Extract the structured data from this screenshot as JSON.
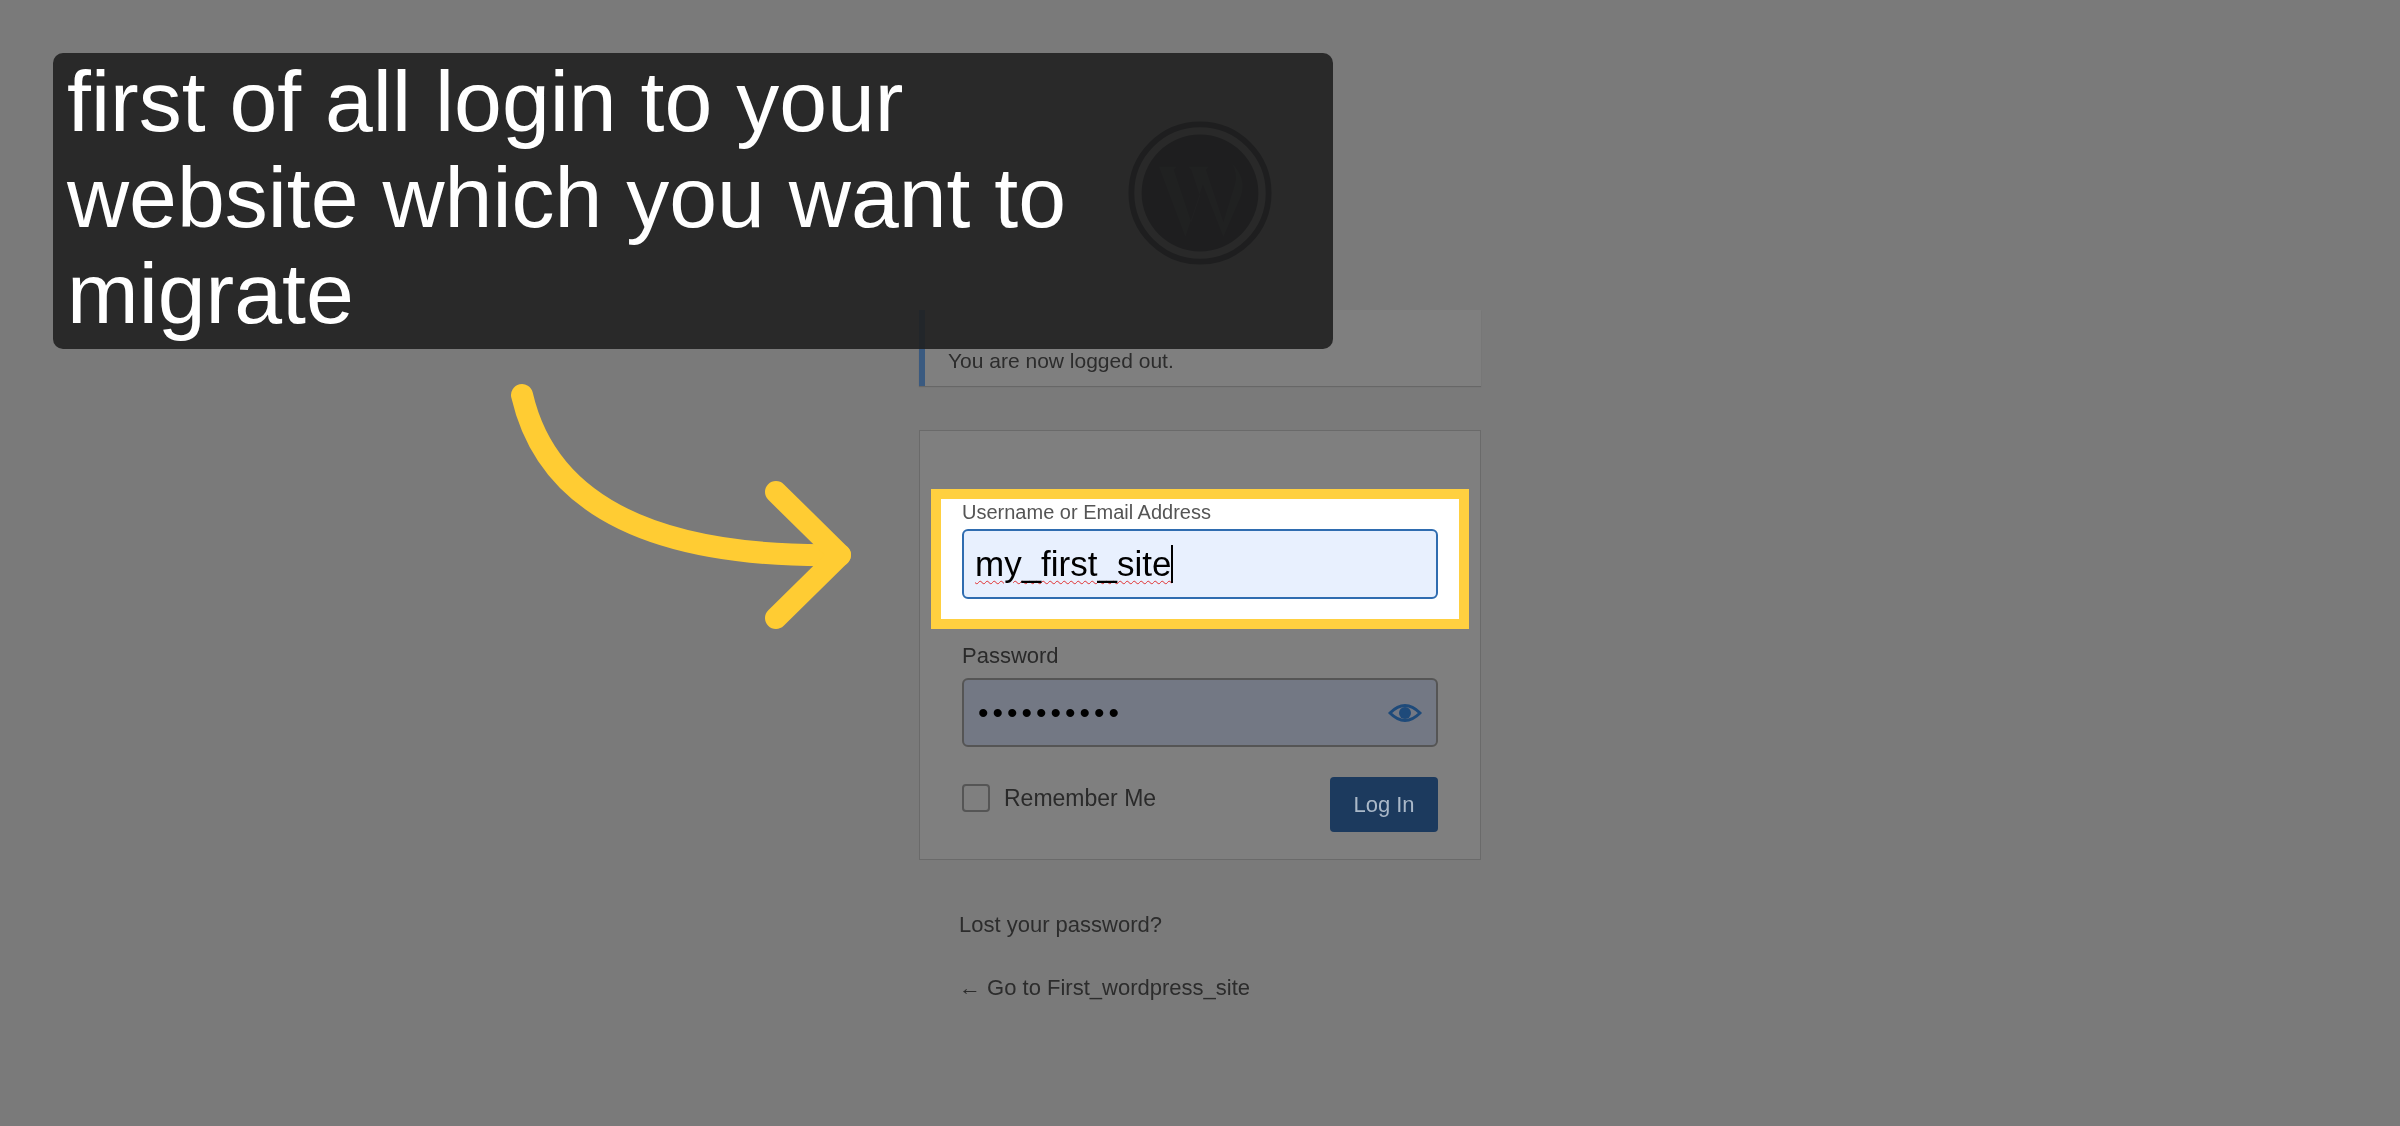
{
  "caption": {
    "text": "first of all login to your website which you want to migrate"
  },
  "notice": {
    "text": "You are now logged out."
  },
  "login_form": {
    "username": {
      "label": "Username or Email Address",
      "value": "my_first_site",
      "highlighted": true
    },
    "password": {
      "label": "Password",
      "value": "••••••••••"
    },
    "remember_me": {
      "label": "Remember Me",
      "checked": false
    },
    "submit": {
      "label": "Log In"
    }
  },
  "links": [
    {
      "text": "Lost your password?"
    },
    {
      "text": "← Go to First_wordpress_site"
    }
  ]
}
